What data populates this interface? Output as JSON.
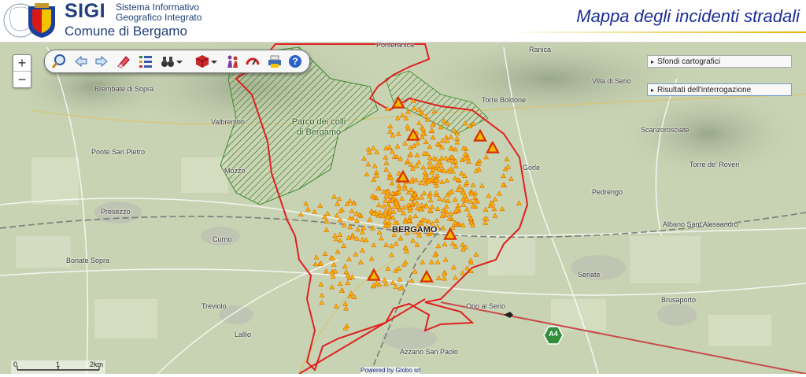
{
  "header": {
    "logo_text": "SIGI",
    "subtitle_line1": "Sistema Informativo",
    "subtitle_line2": "Geografico Integrato",
    "municipality": "Comune di Bergamo",
    "app_title": "Mappa degli incidenti stradali"
  },
  "zoom": {
    "in": "+",
    "out": "−"
  },
  "toolbar": {
    "icons": [
      "zoom-glass-icon",
      "back-arrow-icon",
      "forward-arrow-icon",
      "eraser-icon",
      "layers-list-icon",
      "binoculars-icon",
      "chevron-down-icon",
      "cube-icon",
      "chevron-down-icon",
      "people-icon",
      "speed-icon",
      "print-icon",
      "help-icon"
    ]
  },
  "panels": {
    "basemaps": "Sfondi cartografici",
    "query_results": "Risultati dell'interrogazione"
  },
  "scale": {
    "start": "0",
    "mid": "1",
    "end": "2km"
  },
  "powered_by": "Powered by Globo srl",
  "motorway_label": "A4",
  "places": {
    "ponteranica": "Ponteranica",
    "ranica": "Ranica",
    "villa_di_serio": "Villa di Serio",
    "torre_boldone": "Torre Boldone",
    "brembate": "Brembate di Sopra",
    "valbrembo": "Valbrembo",
    "ponte_san_pietro": "Ponte San Pietro",
    "mozzo": "Mozzo",
    "presezzo": "Presezzo",
    "curno": "Curno",
    "bonate_sopra": "Bonate Sopra",
    "treviolo": "Treviolo",
    "lallio": "Lallio",
    "gorle": "Gorle",
    "scanzorosciate": "Scanzorosciate",
    "torre_de_roveri": "Torre de' Roveri",
    "pedrengo": "Pedrengo",
    "albano": "Albano Sant'Alessandro",
    "seriate": "Seriate",
    "brusaporto": "Brusaporto",
    "orio": "Orio al Serio",
    "azzano": "Azzano San Paolo",
    "bergamo": "BERGAMO",
    "park": "Parco dei colli di Bergamo"
  },
  "legend_colors": {
    "incident": "#f5b800",
    "incident_stroke": "#e05000",
    "boundary": "#e02020",
    "park": "#3f8a2e"
  }
}
